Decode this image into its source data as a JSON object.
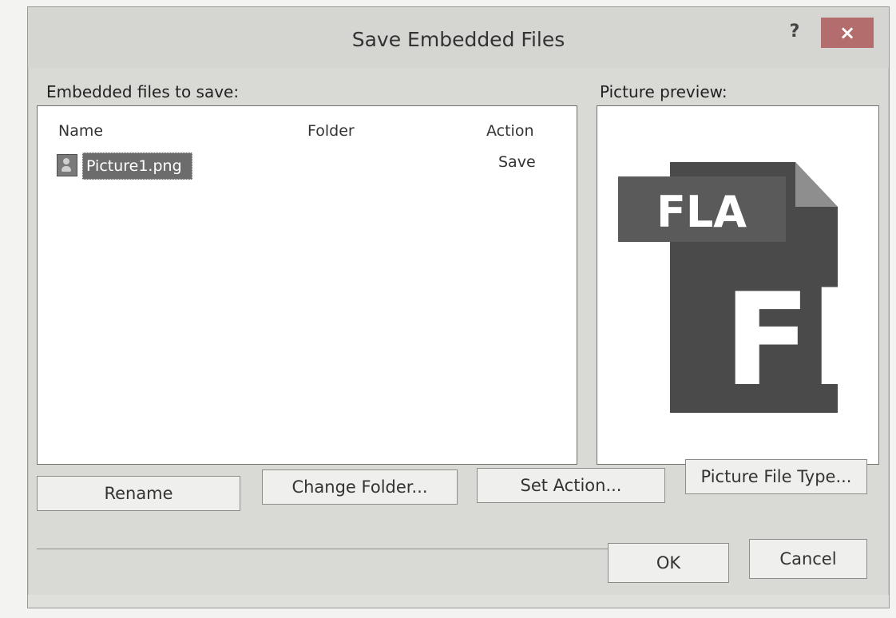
{
  "dialog": {
    "title": "Save Embedded Files",
    "help_glyph": "?",
    "close_glyph": "×"
  },
  "embedded_files": {
    "label": "Embedded files to save:",
    "columns": {
      "name": "Name",
      "folder": "Folder",
      "action": "Action"
    },
    "rows": [
      {
        "name": "Picture1.png",
        "folder": "",
        "action": "Save",
        "icon": "image-file-icon"
      }
    ]
  },
  "preview": {
    "label": "Picture preview:",
    "art_label_top": "FLA",
    "art_label_main": "Fl",
    "art_icon": "flash-file-icon"
  },
  "buttons": {
    "rename": "Rename",
    "change_folder": "Change Folder...",
    "set_action": "Set Action...",
    "picture_file_type": "Picture File Type...",
    "ok": "OK",
    "cancel": "Cancel"
  },
  "colors": {
    "close_button": "#b46d6d",
    "selection": "#6c6c6c",
    "preview_icon": "#4a4a4a"
  }
}
